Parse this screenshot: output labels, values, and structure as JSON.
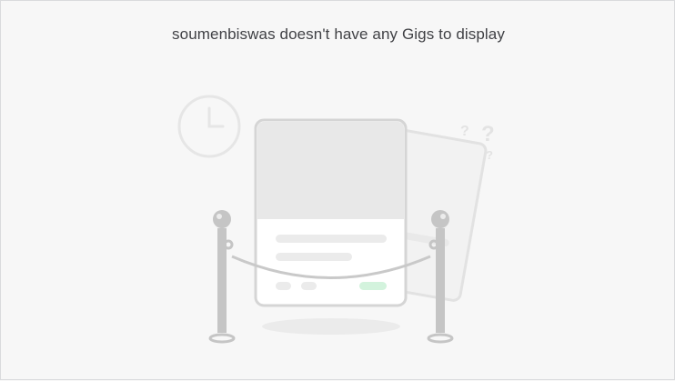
{
  "empty_state": {
    "message": "soumenbiswas doesn't have any Gigs to display",
    "illustration_icons": [
      "clock-icon",
      "question-marks-icon",
      "gig-card-icon",
      "rope-barrier-icon"
    ]
  },
  "colors": {
    "background": "#f7f7f7",
    "border": "#dadbdd",
    "text": "#404145",
    "illustration_gray": "#c5c6c9",
    "card_header": "#e8e8e8",
    "accent_green": "#d3f3dd"
  }
}
